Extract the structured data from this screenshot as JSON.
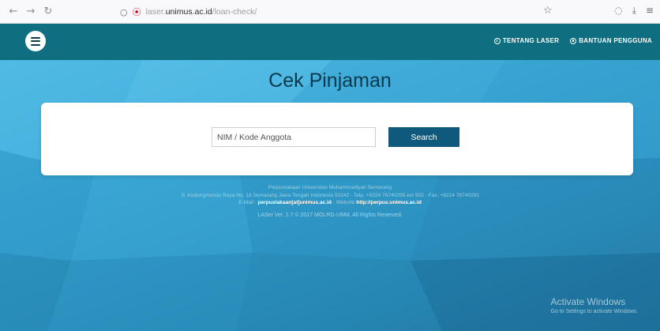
{
  "browser": {
    "back_icon": "←",
    "forward_icon": "→",
    "reload_icon": "↻",
    "shield_icon": "○",
    "lock_icon": "⦿",
    "url_host": "laser.unimus.ac.id",
    "url_path": "/loan-check/",
    "url_prefix": "laser.",
    "url_domain": "unimus.ac.id",
    "star_icon": "☆",
    "pocket_icon": "◌",
    "download_icon": "⤓",
    "extensions_icon": "≡"
  },
  "nav": {
    "about_label": "TENTANG LASER",
    "help_label": "BANTUAN PENGGUNA"
  },
  "page": {
    "title": "Cek Pinjaman"
  },
  "search": {
    "placeholder": "NIM / Kode Anggota",
    "button_label": "Search"
  },
  "footer": {
    "line1": "Perpustakaan Universitas Muhammadiyah Semarang",
    "line2": "Jl. Kedungmundu Raya No. 18 Semarang Jawa Tengah Indonesia 50242 - Telp. +6224 76740295 ext 502 - Fax. +6224 76740291",
    "email_label": "E-Mail : ",
    "email_value": "perpustakaan[at]unimus.ac.id",
    "website_label": " - Website ",
    "website_value": "http://perpus.unimus.ac.id",
    "version": "LASer Ver. 2.7 © 2017 MOLRG-UMM. All Rights Reserved."
  },
  "watermark": {
    "title": "Activate Windows",
    "subtitle": "Go to Settings to activate Windows."
  },
  "colors": {
    "nav_bg": "#0f6f80",
    "button_bg": "#0f5a7c",
    "title_color": "#0d3a4c"
  }
}
